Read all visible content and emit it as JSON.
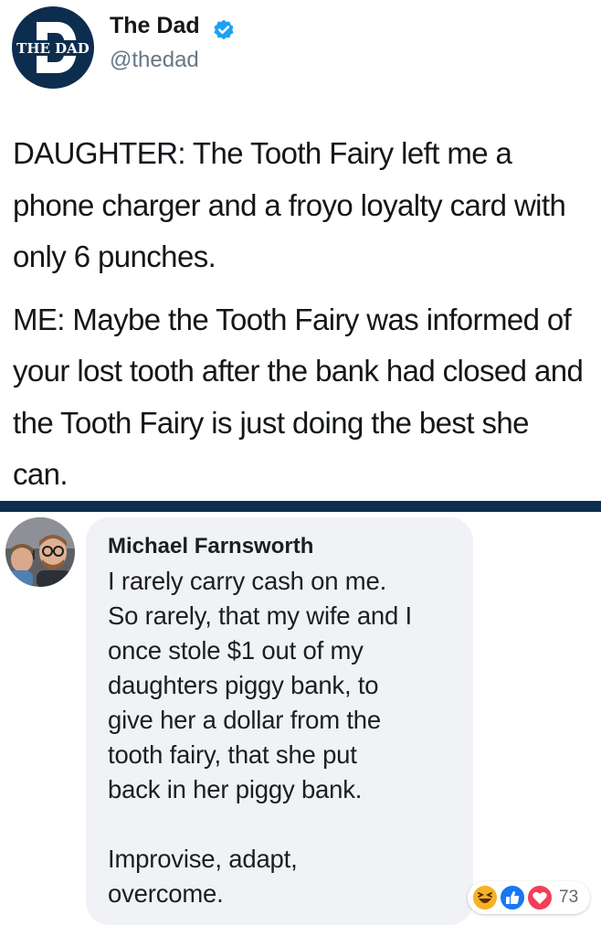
{
  "tweet": {
    "logo": {
      "text": "THE DAD",
      "letter": "D",
      "icon": "the-dad-logo",
      "colors": {
        "navy": "#0d2d4f",
        "white": "#ffffff"
      }
    },
    "author_name": "The Dad",
    "author_handle": "@thedad",
    "verified_icon": "verified-badge-icon",
    "verified_color": "#1da1f2",
    "paragraphs": [
      "DAUGHTER: The Tooth Fairy left me a phone charger and a froyo loyalty card with only 6 punches.",
      "ME: Maybe the Tooth Fairy was informed of your lost tooth after the bank had closed and the Tooth Fairy is just doing the best she can."
    ]
  },
  "divider_color": "#0d2d4f",
  "comment": {
    "author_name": "Michael Farnsworth",
    "avatar_icon": "profile-photo",
    "paragraphs": [
      "I rarely carry cash on me.\nSo rarely, that my wife and I\nonce stole $1 out of my\ndaughters piggy bank, to\ngive her a dollar from the\ntooth fairy, that she put\nback in her piggy bank.",
      "Improvise, adapt,\novercome."
    ],
    "bubble_color": "#f0f2f5",
    "reactions": {
      "icons": [
        "haha-reaction-icon",
        "like-reaction-icon",
        "love-reaction-icon"
      ],
      "count": "73",
      "colors": {
        "haha": "#f7b125",
        "like": "#1877f2",
        "love": "#f33e58"
      }
    }
  }
}
